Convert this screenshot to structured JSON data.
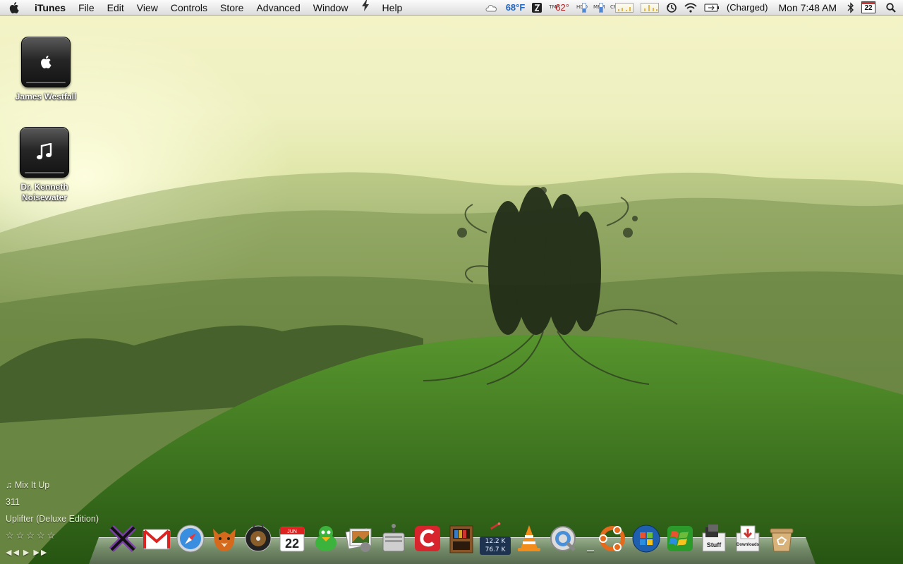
{
  "menubar": {
    "app_name": "iTunes",
    "menus": [
      "File",
      "Edit",
      "View",
      "Controls",
      "Store",
      "Advanced",
      "Window",
      "Help"
    ],
    "status": {
      "weather_temp": "68°F",
      "cpu_temp": "62°",
      "battery_status": "(Charged)",
      "clock": "Mon 7:48 AM",
      "calendar_day": "22",
      "hdd_label": "HDD",
      "mem_label": "MEM",
      "cpu_label": "CPU",
      "tmp_label": "TMP"
    }
  },
  "desktop": {
    "icons": [
      {
        "label": "James Westfall",
        "icon": "apple-drive-icon"
      },
      {
        "label": "Dr. Kenneth Noisewater",
        "icon": "music-note-drive-icon"
      }
    ]
  },
  "now_playing": {
    "track": "Mix It Up",
    "artist": "311",
    "album": "Uplifter (Deluxe Edition)",
    "rating_stars": "☆☆☆☆☆",
    "rating": 0,
    "controls": {
      "prev": "◀◀",
      "play": "▶",
      "next": "▶▶"
    }
  },
  "dock": {
    "network_up": "12.2 K",
    "network_down": "76.7 K",
    "calendar_day": "22",
    "calendar_month": "JUN",
    "stuff_label": "Stuff",
    "downloads_label": "Downloads",
    "items": [
      "finder-x-icon",
      "gmail-icon",
      "safari-icon",
      "firefox-icon",
      "itunes-icon",
      "ical-icon",
      "adium-icon",
      "iphoto-icon",
      "disk-utility-icon",
      "coda-icon",
      "delicious-library-icon",
      "network-monitor-icon",
      "vlc-icon",
      "quicktime-icon",
      "ubuntu-icon",
      "windows-vista-icon",
      "windows-xp-icon",
      "stuff-folder-icon",
      "downloads-folder-icon",
      "trash-icon"
    ]
  }
}
